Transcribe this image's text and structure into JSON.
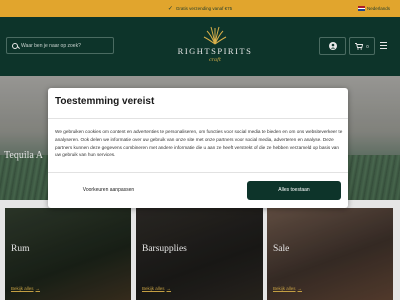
{
  "topbar": {
    "message": "Gratis verzending vanaf €75",
    "language": "Nederlands",
    "flag_colors": [
      "#ae1c28",
      "#ffffff",
      "#21468b"
    ]
  },
  "header": {
    "search_placeholder": "Waar ben je naar op zoek?",
    "logo_name": "RIGHTSPIRITS",
    "logo_sub": "craft",
    "cart_count": "0",
    "icons": {
      "search": "search-icon",
      "account": "user-icon",
      "cart": "cart-icon",
      "menu": "hamburger-menu-icon",
      "logo": "agave-logo-icon"
    }
  },
  "hero": {
    "title": "Tequila A"
  },
  "categories": [
    {
      "label": "Rum",
      "link": "Bekijk alles"
    },
    {
      "label": "Barsupplies",
      "link": "Bekijk alles"
    },
    {
      "label": "Sale",
      "link": "Bekijk alles"
    }
  ],
  "cookie_dialog": {
    "title": "Toestemming vereist",
    "body": "We gebruiken cookies om content en advertenties te personaliseren, om functies voor social media te bieden en om ons websiteverkeer te analyseren. Ook delen we informatie over uw gebruik van onze site met onze partners voor social media, adverteren en analyse. Deze partners kunnen deze gegevens combineren met andere informatie die u aan ze heeft verstrekt of die ze hebben verzameld op basis van uw gebruik van hun services.",
    "customize_label": "Voorkeuren aanpassen",
    "accept_label": "Alles toestaan"
  },
  "colors": {
    "brand_green": "#0d342a",
    "gold": "#e1a52d",
    "accent_gold": "#d9b04a"
  }
}
